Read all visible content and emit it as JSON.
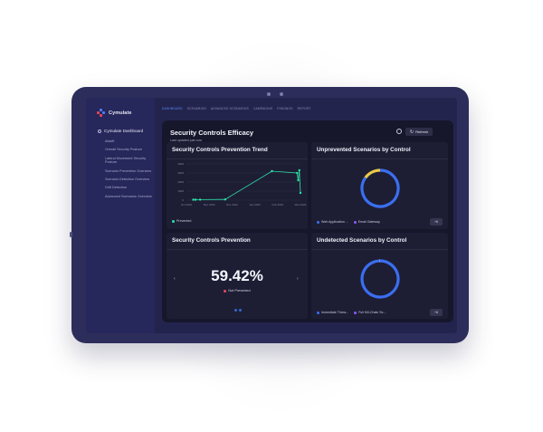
{
  "app": {
    "name": "Cymulate"
  },
  "sidebar": {
    "dashboard_label": "Cymulate Dashboard",
    "items": [
      {
        "label": "AttaW"
      },
      {
        "label": "Overall Security Posture"
      },
      {
        "label": "Lateral Movement Security Posture"
      },
      {
        "label": "Scenario Prevention Overview"
      },
      {
        "label": "Scenario Detection Overview"
      },
      {
        "label": "Drift Detection"
      },
      {
        "label": "Advanced Scenarios Overview"
      }
    ]
  },
  "tabs": [
    {
      "label": "DASHBOARD",
      "active": true
    },
    {
      "label": "SCENARIOS",
      "active": false
    },
    {
      "label": "ADVANCED SCENARIOS",
      "active": false
    },
    {
      "label": "CAMPAIGNS",
      "active": false
    },
    {
      "label": "FINDINGS",
      "active": false
    },
    {
      "label": "REPORT",
      "active": false
    }
  ],
  "panel": {
    "title": "Security Controls Efficacy",
    "subtitle": "Last updated just now",
    "refresh_label": "Refresh"
  },
  "cards": {
    "trend": {
      "title": "Security Controls Prevention Trend",
      "legend": "Prevented"
    },
    "unprevented": {
      "title": "Unprevented Scenarios by Control",
      "legend": [
        "Web Application ...",
        "Email Gateway"
      ],
      "more": "+6"
    },
    "prevention": {
      "title": "Security Controls Prevention",
      "value": "59.42%",
      "label": "Not Prevented"
    },
    "undetected": {
      "title": "Undetected Scenarios by Control",
      "legend": [
        "Immediate Threa...",
        "Full Kill-Chain Sc..."
      ],
      "more": "+6"
    }
  },
  "chart_data": [
    {
      "type": "line",
      "title": "Security Controls Prevention Trend",
      "x": [
        "Oct 2022",
        "Dec 2022",
        "Nov 2022",
        "Jan 2023",
        "Feb 2023",
        "Mar 2023"
      ],
      "y_ticks": [
        0,
        1000,
        2000,
        3000,
        4000
      ],
      "ylim": [
        0,
        4000
      ],
      "series": [
        {
          "name": "Prevented",
          "color": "#2fe0a8",
          "values": [
            50,
            50,
            60,
            80,
            3200,
            3000,
            2200,
            3300,
            800
          ]
        }
      ]
    },
    {
      "type": "pie",
      "title": "Unprevented Scenarios by Control",
      "labels": [
        "Web Application ...",
        "Email Gateway"
      ],
      "values": [
        85,
        15
      ],
      "colors": [
        "#3b6ff0",
        "#e8c84a"
      ]
    },
    {
      "type": "pie",
      "title": "Undetected Scenarios by Control",
      "labels": [
        "Immediate Threa...",
        "Full Kill-Chain Sc..."
      ],
      "values": [
        99,
        1
      ],
      "colors": [
        "#3b6ff0",
        "#7f8cff"
      ]
    }
  ],
  "colors": {
    "accent": "#3b6ff0",
    "success": "#2fe0a8",
    "danger": "#e84a5f",
    "purple": "#8b5cf6"
  }
}
